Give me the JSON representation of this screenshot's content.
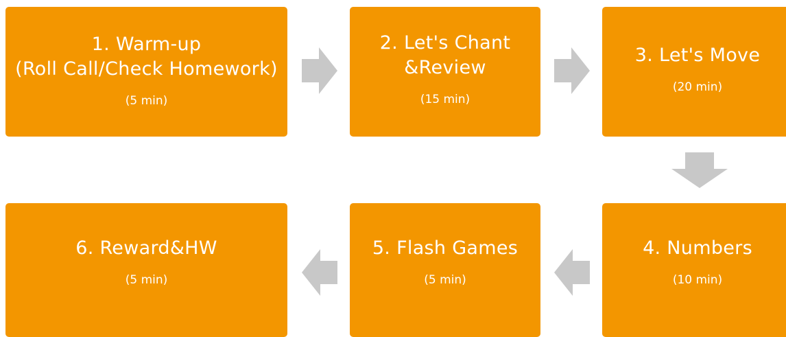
{
  "steps": [
    {
      "title_lines": [
        "1. Warm-up",
        "(Roll Call/Check Homework)"
      ],
      "duration": "(5 min)"
    },
    {
      "title_lines": [
        "2. Let's Chant",
        "&Review"
      ],
      "duration": "(15 min)"
    },
    {
      "title_lines": [
        "3. Let's Move"
      ],
      "duration": "(20 min)"
    },
    {
      "title_lines": [
        "4. Numbers"
      ],
      "duration": "(10 min)"
    },
    {
      "title_lines": [
        "5. Flash Games"
      ],
      "duration": "(5 min)"
    },
    {
      "title_lines": [
        "6. Reward&HW"
      ],
      "duration": "(5 min)"
    }
  ],
  "colors": {
    "box_fill": "#f39600",
    "box_text": "#ffffff",
    "arrow_fill": "#c8c8c8"
  },
  "arrows": [
    "right",
    "right",
    "down",
    "left",
    "left"
  ]
}
